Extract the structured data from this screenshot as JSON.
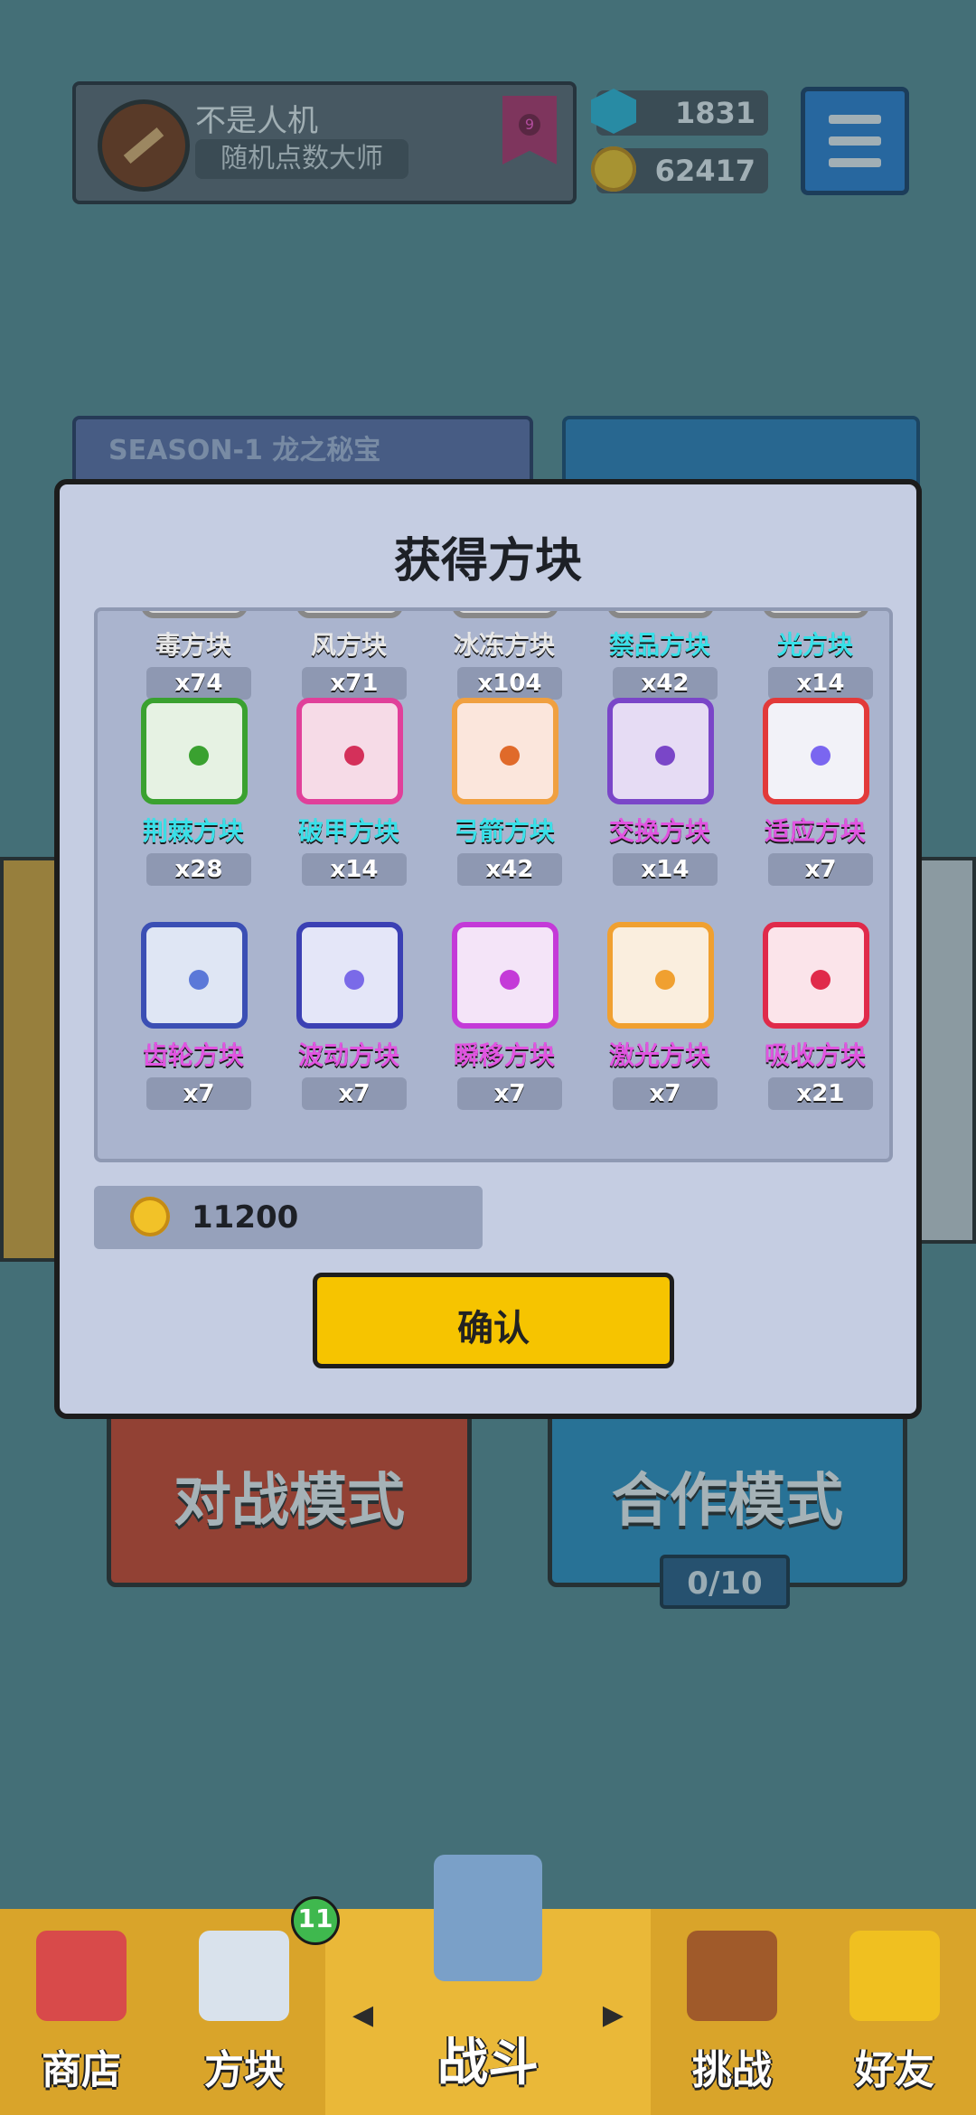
{
  "profile": {
    "name": "不是人机",
    "title": "随机点数大师",
    "rank_level": "9"
  },
  "resources": {
    "gems": "1831",
    "coins": "62417"
  },
  "background": {
    "season_banner": "SEASON-1 龙之秘宝",
    "battle_mode": "对战模式",
    "coop_mode": "合作模式",
    "coop_progress": "0/10"
  },
  "nav": {
    "shop": "商店",
    "blocks": "方块",
    "blocks_badge": "11",
    "battle": "战斗",
    "challenge": "挑战",
    "friends": "好友"
  },
  "modal": {
    "title": "获得方块",
    "items": [
      {
        "name": "毒方块",
        "count": "x74",
        "name_color": "#e8e8e8",
        "border": "#888",
        "fill": "#ddd",
        "dot": "#555",
        "partial": true
      },
      {
        "name": "风方块",
        "count": "x71",
        "name_color": "#e8e8e8",
        "border": "#888",
        "fill": "#ddd",
        "dot": "#555",
        "partial": true
      },
      {
        "name": "冰冻方块",
        "count": "x104",
        "name_color": "#e8e8e8",
        "border": "#888",
        "fill": "#ddd",
        "dot": "#555",
        "partial": true
      },
      {
        "name": "禁品方块",
        "count": "x42",
        "name_color": "#39e0e8",
        "border": "#888",
        "fill": "#ddd",
        "dot": "#555",
        "partial": true
      },
      {
        "name": "光方块",
        "count": "x14",
        "name_color": "#39e0e8",
        "border": "#888",
        "fill": "#ddd",
        "dot": "#555",
        "partial": true
      },
      {
        "name": "荆棘方块",
        "count": "x28",
        "name_color": "#39e0e8",
        "border": "#3aa130",
        "fill": "#e6f2e3",
        "dot": "#3aa130"
      },
      {
        "name": "破甲方块",
        "count": "x14",
        "name_color": "#39e0e8",
        "border": "#e0409a",
        "fill": "#f6dbe7",
        "dot": "#d4305a"
      },
      {
        "name": "弓箭方块",
        "count": "x42",
        "name_color": "#39e0e8",
        "border": "#f0a040",
        "fill": "#fbe6dc",
        "dot": "#e06a2a"
      },
      {
        "name": "交换方块",
        "count": "x14",
        "name_color": "#e055e0",
        "border": "#7a46c8",
        "fill": "#e6dcf4",
        "dot": "#7a46c8"
      },
      {
        "name": "适应方块",
        "count": "x7",
        "name_color": "#e055e0",
        "border": "#e23a3a",
        "fill": "#f2f2f8",
        "dot": "#7a66f0"
      },
      {
        "name": "齿轮方块",
        "count": "x7",
        "name_color": "#e055e0",
        "border": "#3b4fb4",
        "fill": "#dfe6f4",
        "dot": "#5b78d8"
      },
      {
        "name": "波动方块",
        "count": "x7",
        "name_color": "#e055e0",
        "border": "#3b40b4",
        "fill": "#e4e6f8",
        "dot": "#7a6ae8"
      },
      {
        "name": "瞬移方块",
        "count": "x7",
        "name_color": "#e055e0",
        "border": "#c43ad8",
        "fill": "#f4e4f8",
        "dot": "#c43ad8"
      },
      {
        "name": "激光方块",
        "count": "x7",
        "name_color": "#e055e0",
        "border": "#f0a030",
        "fill": "#faeede",
        "dot": "#f0a030"
      },
      {
        "name": "吸收方块",
        "count": "x21",
        "name_color": "#e055e0",
        "border": "#e02a4a",
        "fill": "#fbe4ea",
        "dot": "#e02a4a"
      }
    ],
    "coin_reward": "11200",
    "confirm": "确认"
  }
}
